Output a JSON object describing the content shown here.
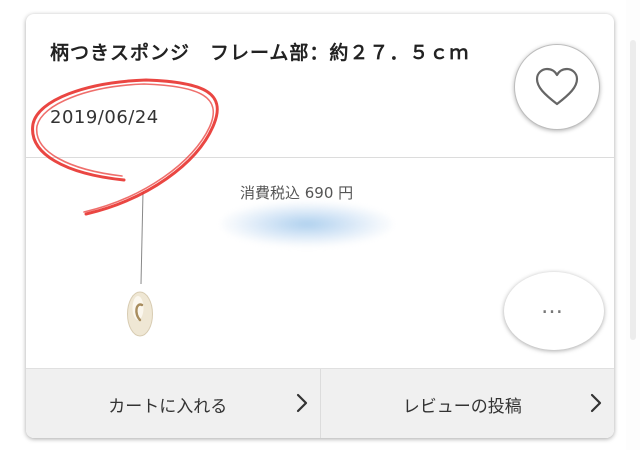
{
  "product": {
    "title": "柄つきスポンジ　フレーム部：約２７．５ｃｍ",
    "date": "2019/06/24",
    "price": "消費税込 690 円"
  },
  "buttons": {
    "cart_label": "カートに入れる",
    "review_label": "レビューの投稿",
    "more_label": "…"
  },
  "icons": {
    "favorite": "heart-outline-icon",
    "more": "ellipsis-icon",
    "chevron": "chevron-right-icon"
  },
  "colors": {
    "annotation": "#e8322e",
    "footer_bg": "#f0f0f0"
  }
}
